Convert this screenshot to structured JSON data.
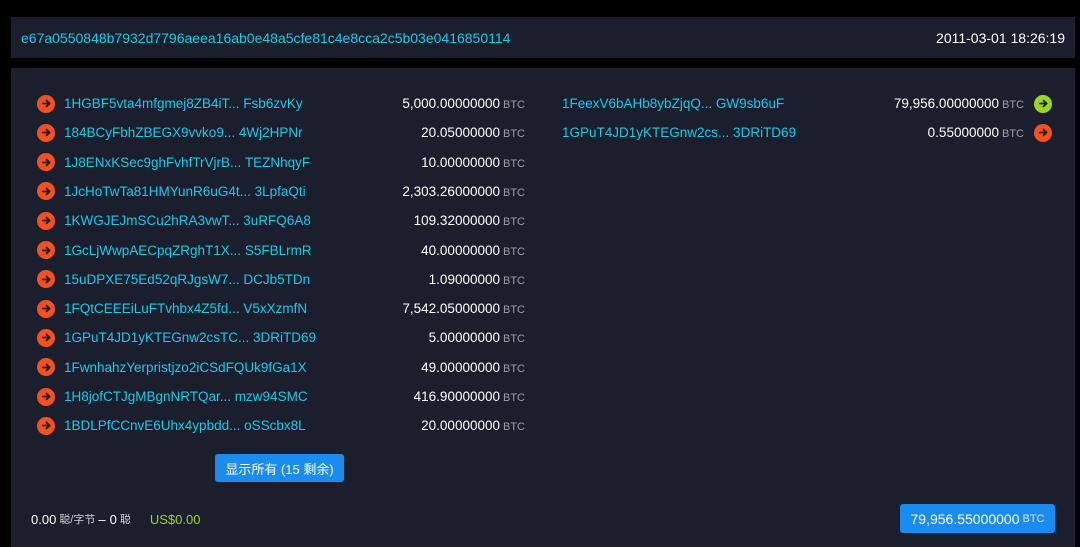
{
  "tx": {
    "hash": "e67a0550848b7932d7796aeea16ab0e48a5cfe81c4e8cca2c5b03e0416850114",
    "time": "2011-03-01 18:26:19"
  },
  "unit_label": "BTC",
  "inputs": [
    {
      "addr": "1HGBF5vta4mfgmej8ZB4iT... Fsb6zvKy",
      "amount": "5,000.00000000"
    },
    {
      "addr": "184BCyFbhZBEGX9vvko9... 4Wj2HPNr",
      "amount": "20.05000000"
    },
    {
      "addr": "1J8ENxKSec9ghFvhfTrVjrB... TEZNhqyF",
      "amount": "10.00000000"
    },
    {
      "addr": "1JcHoTwTa81HMYunR6uG4t... 3LpfaQti",
      "amount": "2,303.26000000"
    },
    {
      "addr": "1KWGJEJmSCu2hRA3vwT... 3uRFQ6A8",
      "amount": "109.32000000"
    },
    {
      "addr": "1GcLjWwpAECpqZRghT1X... S5FBLrmR",
      "amount": "40.00000000"
    },
    {
      "addr": "15uDPXE75Ed52qRJgsW7... DCJb5TDn",
      "amount": "1.09000000"
    },
    {
      "addr": "1FQtCEEEiLuFTvhbx4Z5fd... V5xXzmfN",
      "amount": "7,542.05000000"
    },
    {
      "addr": "1GPuT4JD1yKTEGnw2csTC... 3DRiTD69",
      "amount": "5.00000000"
    },
    {
      "addr": "1FwnhahzYerpristjzo2iCSdFQUk9fGa1X",
      "amount": "49.00000000"
    },
    {
      "addr": "1H8jofCTJgMBgnNRTQar... mzw94SMC",
      "amount": "416.90000000"
    },
    {
      "addr": "1BDLPfCCnvE6Uhx4ypbdd... oSScbx8L",
      "amount": "20.00000000"
    }
  ],
  "outputs": [
    {
      "addr": "1FeexV6bAHb8ybZjqQ... GW9sb6uF",
      "amount": "79,956.00000000",
      "icon": "arrow-right-icon",
      "icon_color": "#9bd522"
    },
    {
      "addr": "1GPuT4JD1yKTEGnw2cs... 3DRiTD69",
      "amount": "0.55000000",
      "icon": "arrow-right-icon",
      "icon_color": "#f4511e"
    }
  ],
  "show_all_label": "显示所有 (15 剩余)",
  "fee": {
    "rate": "0.00",
    "rate_unit": "聪/字节",
    "dash": "–",
    "total": "0",
    "total_unit": "聪",
    "usd": "US$0.00"
  },
  "total": {
    "amount": "79,956.55000000",
    "unit": "BTC"
  },
  "colors": {
    "accent": "#1a8cf0",
    "address": "#1dc9e8",
    "input_icon": "#f4511e",
    "output_icon_spent": "#f4511e",
    "output_icon_unspent": "#9bd522",
    "usd": "#9bd522"
  }
}
